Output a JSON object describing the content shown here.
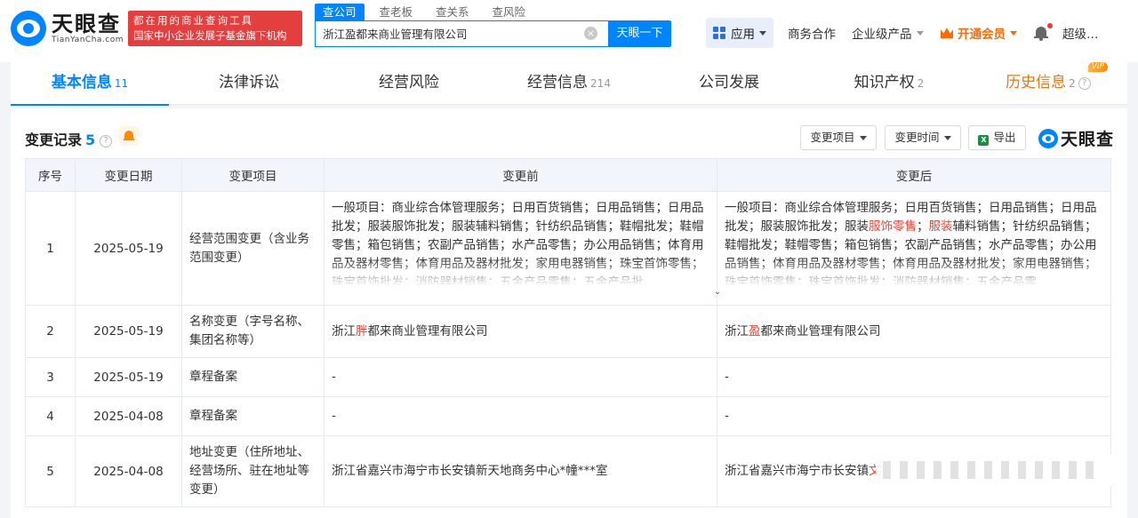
{
  "header": {
    "logo_cn": "天眼查",
    "logo_en": "TianYanCha.com",
    "slogan_line1": "都在用的商业查询工具",
    "slogan_line2": "国家中小企业发展子基金旗下机构",
    "search_tabs": [
      "查公司",
      "查老板",
      "查关系",
      "查风险"
    ],
    "search_value": "浙江盈都来商业管理有限公司",
    "search_button": "天眼一下",
    "app_label": "应用",
    "biz_coop": "商务合作",
    "enterprise": "企业级产品",
    "vip": "开通会员",
    "user": "超级…"
  },
  "tabs": [
    {
      "label": "基本信息",
      "count": "11"
    },
    {
      "label": "法律诉讼",
      "count": ""
    },
    {
      "label": "经营风险",
      "count": ""
    },
    {
      "label": "经营信息",
      "count": "214"
    },
    {
      "label": "公司发展",
      "count": ""
    },
    {
      "label": "知识产权",
      "count": "2"
    },
    {
      "label": "历史信息",
      "count": "2",
      "badge": "VIP"
    }
  ],
  "section": {
    "title": "变更记录",
    "count": "5",
    "btn_item": "变更项目",
    "btn_time": "变更时间",
    "btn_export": "导出",
    "brand": "天眼查"
  },
  "table": {
    "headers": [
      "序号",
      "变更日期",
      "变更项目",
      "变更前",
      "变更后"
    ],
    "rows": [
      {
        "no": "1",
        "date": "2025-05-19",
        "item": "经营范围变更（含业务范围变更）",
        "before": "一般项目：商业综合体管理服务；日用百货销售；日用品销售；日用品批发；服装服饰批发；服装辅料销售；针纺织品销售；鞋帽批发；鞋帽零售；箱包销售；农副产品销售；水产品零售；办公用品销售；体育用品及器材零售；体育用品及器材批发；家用电器销售；珠宝首饰零售；珠宝首饰批发；消防器材销售；五金产品零售；五金产品批",
        "after_p1": "一般项目：商业综合体管理服务；日用百货销售；日用品销售；日用品批发；服装服饰批发；服装",
        "after_hl1": "服饰零售",
        "after_p2": "；",
        "after_hl2": "服装",
        "after_p3": "辅料销售；针纺织品销售；鞋帽批发；鞋帽零售；箱包销售；农副产品销售；水产品零售；办公用品销售；体育用品及器材零售；体育用品及器材批发；家用电器销售；珠宝首饰零售；珠宝首饰批发；消防器材销售；五金产品零"
      },
      {
        "no": "2",
        "date": "2025-05-19",
        "item": "名称变更（字号名称、集团名称等）",
        "before_p1": "浙江",
        "before_hl": "胖",
        "before_p2": "都来商业管理有限公司",
        "after_p1": "浙江",
        "after_hl": "盈",
        "after_p2": "都来商业管理有限公司"
      },
      {
        "no": "3",
        "date": "2025-05-19",
        "item": "章程备案",
        "before": "-",
        "after": "-"
      },
      {
        "no": "4",
        "date": "2025-04-08",
        "item": "章程备案",
        "before": "-",
        "after": "-"
      },
      {
        "no": "5",
        "date": "2025-04-08",
        "item": "地址变更（住所地址、经营场所、驻在地址等变更）",
        "before": "浙江省嘉兴市海宁市长安镇新天地商务中心*幢***室",
        "after_p1": "浙江省嘉兴市海宁市长安镇",
        "after_hl": "文"
      }
    ]
  }
}
